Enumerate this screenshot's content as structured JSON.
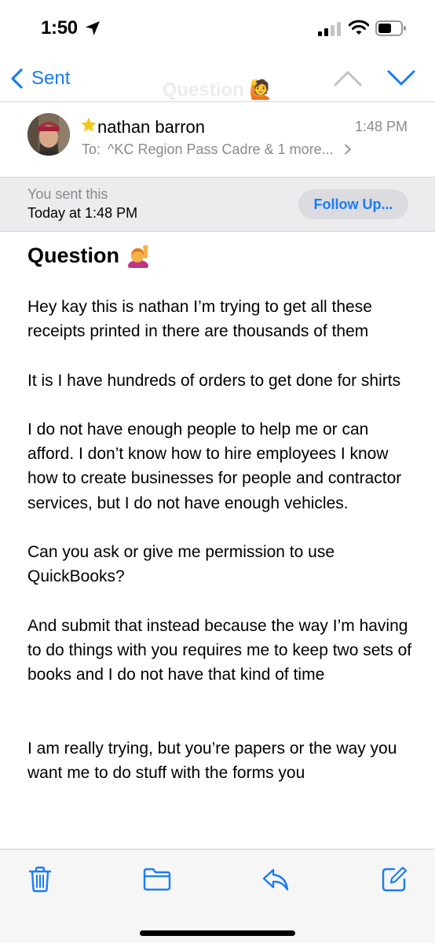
{
  "status_bar": {
    "time": "1:50",
    "icons": [
      "location-arrow-icon",
      "cellular-signal-icon",
      "wifi-icon",
      "battery-icon"
    ]
  },
  "nav": {
    "back_label": "Sent",
    "ghost_title": "Question 🙋"
  },
  "header": {
    "sender": "nathan barron",
    "time": "1:48 PM",
    "to_prefix": "To:",
    "to_recipients": "^KC Region Pass Cadre & 1 more..."
  },
  "sent_banner": {
    "line1": "You sent this",
    "line2": "Today at 1:48 PM",
    "follow_up_label": "Follow Up..."
  },
  "email": {
    "subject": "Question",
    "paragraphs": [
      "Hey kay this is nathan I’m trying to get all these receipts printed in there are thousands of them",
      "It is I have hundreds of orders to get done for shirts",
      "I do not have enough people to help me or can afford. I don’t know how to hire employees I know how to create businesses for people and contractor services, but I do not have enough vehicles.",
      "Can you ask or give me permission to use QuickBooks?",
      "And submit that instead because the way I’m having to do things with you requires me to keep two sets of books and I do not have that kind of time",
      "I am really trying, but you’re papers or the way you want me to do stuff with the forms you"
    ]
  },
  "toolbar": {
    "icons": [
      "trash-icon",
      "folder-icon",
      "reply-icon",
      "compose-icon"
    ]
  },
  "colors": {
    "accent": "#1a7cf5",
    "secondary_text": "#8a8a8e",
    "banner_bg": "#ececee",
    "star": "#f5c518"
  }
}
